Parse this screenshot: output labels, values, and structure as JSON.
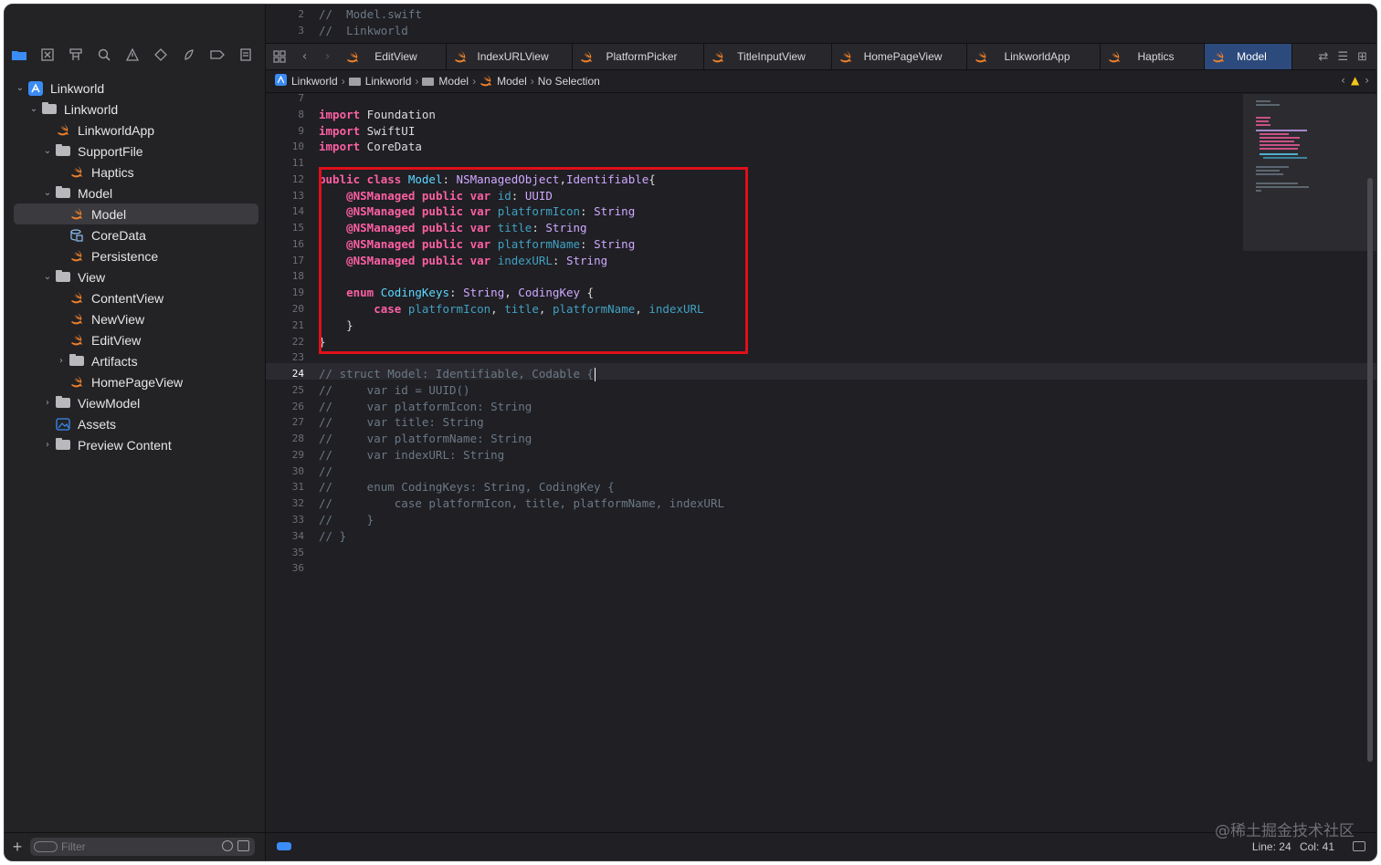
{
  "sidebar": {
    "toolbar_icons": [
      "folder-icon",
      "source-control-icon",
      "symbol-icon",
      "search-icon",
      "warning-icon",
      "test-icon",
      "debug-icon",
      "breakpoint-icon",
      "report-icon"
    ],
    "tree": [
      {
        "label": "Linkworld",
        "kind": "project",
        "depth": 0,
        "chevron": "⌄"
      },
      {
        "label": "Linkworld",
        "kind": "folder",
        "depth": 1,
        "chevron": "⌄"
      },
      {
        "label": "LinkworldApp",
        "kind": "swift",
        "depth": 2,
        "chevron": ""
      },
      {
        "label": "SupportFile",
        "kind": "folder",
        "depth": 2,
        "chevron": "⌄"
      },
      {
        "label": "Haptics",
        "kind": "swift",
        "depth": 3,
        "chevron": ""
      },
      {
        "label": "Model",
        "kind": "folder",
        "depth": 2,
        "chevron": "⌄"
      },
      {
        "label": "Model",
        "kind": "swift",
        "depth": 3,
        "chevron": "",
        "selected": true
      },
      {
        "label": "CoreData",
        "kind": "coredata",
        "depth": 3,
        "chevron": ""
      },
      {
        "label": "Persistence",
        "kind": "swift",
        "depth": 3,
        "chevron": ""
      },
      {
        "label": "View",
        "kind": "folder",
        "depth": 2,
        "chevron": "⌄"
      },
      {
        "label": "ContentView",
        "kind": "swift",
        "depth": 3,
        "chevron": ""
      },
      {
        "label": "NewView",
        "kind": "swift",
        "depth": 3,
        "chevron": ""
      },
      {
        "label": "EditView",
        "kind": "swift",
        "depth": 3,
        "chevron": ""
      },
      {
        "label": "Artifacts",
        "kind": "folder",
        "depth": 3,
        "chevron": "›"
      },
      {
        "label": "HomePageView",
        "kind": "swift",
        "depth": 3,
        "chevron": ""
      },
      {
        "label": "ViewModel",
        "kind": "folder",
        "depth": 2,
        "chevron": "›"
      },
      {
        "label": "Assets",
        "kind": "assets",
        "depth": 2,
        "chevron": ""
      },
      {
        "label": "Preview Content",
        "kind": "folder",
        "depth": 2,
        "chevron": "›"
      }
    ],
    "filter_placeholder": "Filter"
  },
  "tabs": [
    {
      "label": "EditView",
      "active": false
    },
    {
      "label": "IndexURLView",
      "active": false
    },
    {
      "label": "PlatformPicker",
      "active": false
    },
    {
      "label": "TitleInputView",
      "active": false
    },
    {
      "label": "HomePageView",
      "active": false
    },
    {
      "label": "LinkworldApp",
      "active": false
    },
    {
      "label": "Haptics",
      "active": false
    },
    {
      "label": "Model",
      "active": true
    }
  ],
  "jumpbar": [
    "Linkworld",
    "Linkworld",
    "Model",
    "Model",
    "No Selection"
  ],
  "code_top": [
    {
      "n": "2",
      "text": "//  Model.swift"
    },
    {
      "n": "3",
      "text": "//  Linkworld"
    }
  ],
  "code": [
    {
      "n": "7",
      "parts": []
    },
    {
      "n": "8",
      "parts": [
        [
          "kw",
          "import"
        ],
        [
          "tx",
          " Foundation"
        ]
      ]
    },
    {
      "n": "9",
      "parts": [
        [
          "kw",
          "import"
        ],
        [
          "tx",
          " SwiftUI"
        ]
      ]
    },
    {
      "n": "10",
      "parts": [
        [
          "kw",
          "import"
        ],
        [
          "tx",
          " CoreData"
        ]
      ]
    },
    {
      "n": "11",
      "parts": []
    },
    {
      "n": "12",
      "parts": [
        [
          "kw",
          "public class"
        ],
        [
          "tx",
          " "
        ],
        [
          "ty",
          "Model"
        ],
        [
          "tx",
          ": "
        ],
        [
          "std",
          "NSManagedObject"
        ],
        [
          "tx",
          ","
        ],
        [
          "std",
          "Identifiable"
        ],
        [
          "tx",
          "{"
        ]
      ]
    },
    {
      "n": "13",
      "parts": [
        [
          "tx",
          "    "
        ],
        [
          "kw",
          "@NSManaged public var"
        ],
        [
          "tx",
          " "
        ],
        [
          "pr",
          "id"
        ],
        [
          "tx",
          ": "
        ],
        [
          "std",
          "UUID"
        ]
      ]
    },
    {
      "n": "14",
      "parts": [
        [
          "tx",
          "    "
        ],
        [
          "kw",
          "@NSManaged public var"
        ],
        [
          "tx",
          " "
        ],
        [
          "pr",
          "platformIcon"
        ],
        [
          "tx",
          ": "
        ],
        [
          "std",
          "String"
        ]
      ]
    },
    {
      "n": "15",
      "parts": [
        [
          "tx",
          "    "
        ],
        [
          "kw",
          "@NSManaged public var"
        ],
        [
          "tx",
          " "
        ],
        [
          "pr",
          "title"
        ],
        [
          "tx",
          ": "
        ],
        [
          "std",
          "String"
        ]
      ]
    },
    {
      "n": "16",
      "parts": [
        [
          "tx",
          "    "
        ],
        [
          "kw",
          "@NSManaged public var"
        ],
        [
          "tx",
          " "
        ],
        [
          "pr",
          "platformName"
        ],
        [
          "tx",
          ": "
        ],
        [
          "std",
          "String"
        ]
      ]
    },
    {
      "n": "17",
      "parts": [
        [
          "tx",
          "    "
        ],
        [
          "kw",
          "@NSManaged public var"
        ],
        [
          "tx",
          " "
        ],
        [
          "pr",
          "indexURL"
        ],
        [
          "tx",
          ": "
        ],
        [
          "std",
          "String"
        ]
      ]
    },
    {
      "n": "18",
      "parts": []
    },
    {
      "n": "19",
      "parts": [
        [
          "tx",
          "    "
        ],
        [
          "kw",
          "enum"
        ],
        [
          "tx",
          " "
        ],
        [
          "ty",
          "CodingKeys"
        ],
        [
          "tx",
          ": "
        ],
        [
          "std",
          "String"
        ],
        [
          "tx",
          ", "
        ],
        [
          "std",
          "CodingKey"
        ],
        [
          "tx",
          " {"
        ]
      ]
    },
    {
      "n": "20",
      "parts": [
        [
          "tx",
          "        "
        ],
        [
          "kw",
          "case"
        ],
        [
          "tx",
          " "
        ],
        [
          "pr",
          "platformIcon"
        ],
        [
          "tx",
          ", "
        ],
        [
          "pr",
          "title"
        ],
        [
          "tx",
          ", "
        ],
        [
          "pr",
          "platformName"
        ],
        [
          "tx",
          ", "
        ],
        [
          "pr",
          "indexURL"
        ]
      ]
    },
    {
      "n": "21",
      "parts": [
        [
          "tx",
          "    }"
        ]
      ]
    },
    {
      "n": "22",
      "parts": [
        [
          "tx",
          "}"
        ]
      ]
    },
    {
      "n": "23",
      "parts": []
    },
    {
      "n": "24",
      "parts": [
        [
          "cm",
          "// struct Model: Identifiable, Codable {"
        ]
      ],
      "current": true
    },
    {
      "n": "25",
      "parts": [
        [
          "cm",
          "//     var id = UUID()"
        ]
      ]
    },
    {
      "n": "26",
      "parts": [
        [
          "cm",
          "//     var platformIcon: String"
        ]
      ]
    },
    {
      "n": "27",
      "parts": [
        [
          "cm",
          "//     var title: String"
        ]
      ]
    },
    {
      "n": "28",
      "parts": [
        [
          "cm",
          "//     var platformName: String"
        ]
      ]
    },
    {
      "n": "29",
      "parts": [
        [
          "cm",
          "//     var indexURL: String"
        ]
      ]
    },
    {
      "n": "30",
      "parts": [
        [
          "cm",
          "//"
        ]
      ]
    },
    {
      "n": "31",
      "parts": [
        [
          "cm",
          "//     enum CodingKeys: String, CodingKey {"
        ]
      ]
    },
    {
      "n": "32",
      "parts": [
        [
          "cm",
          "//         case platformIcon, title, platformName, indexURL"
        ]
      ]
    },
    {
      "n": "33",
      "parts": [
        [
          "cm",
          "//     }"
        ]
      ]
    },
    {
      "n": "34",
      "parts": [
        [
          "cm",
          "// }"
        ]
      ]
    },
    {
      "n": "35",
      "parts": []
    },
    {
      "n": "36",
      "parts": []
    }
  ],
  "status": {
    "line": "Line: 24",
    "col": "Col: 41"
  },
  "watermark": "@稀土掘金技术社区",
  "colors": {
    "accent": "#3b8cf5",
    "highlight_box": "#e0101a",
    "swift_orange": "#f0812b",
    "keyword": "#fc5fa3"
  }
}
